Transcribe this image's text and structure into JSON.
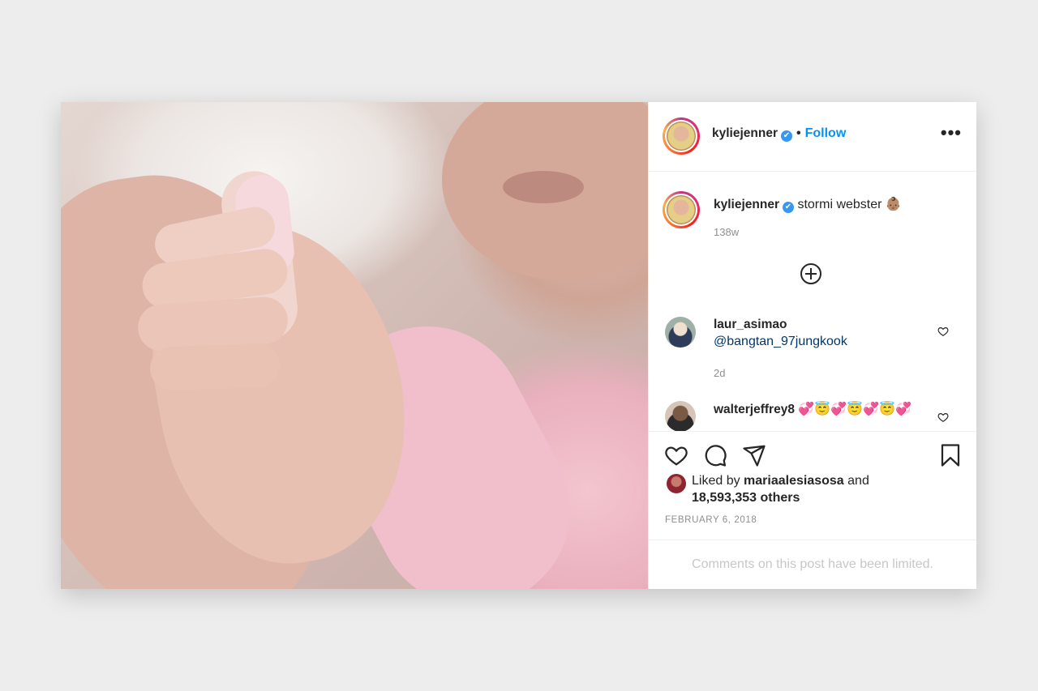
{
  "post": {
    "author": "kyliejenner",
    "follow_label": "Follow",
    "dot": "•",
    "more_label": "•••",
    "verified_mark": "✔",
    "caption": "stormi webster 👶🏽",
    "caption_age": "138w",
    "image_alt": "Baby hand holding adult finger"
  },
  "comments": [
    {
      "user": "laur_asimao",
      "text": "@bangtan_97jungkook",
      "age": "2d"
    },
    {
      "user": "walterjeffrey8",
      "text": "💞😇💞😇💞😇💞"
    }
  ],
  "likes": {
    "prefix": "Liked by",
    "user": "mariaalesiasosa",
    "conj": "and",
    "others": "18,593,353 others"
  },
  "date": "FEBRUARY 6, 2018",
  "comments_limited": "Comments on this post have been limited.",
  "colors": {
    "link": "#0095f6",
    "verified": "#3897f0",
    "mention": "#00376b"
  },
  "icons": [
    "heart-icon",
    "comment-icon",
    "share-icon",
    "bookmark-icon",
    "plus-circle-icon",
    "more-icon"
  ]
}
